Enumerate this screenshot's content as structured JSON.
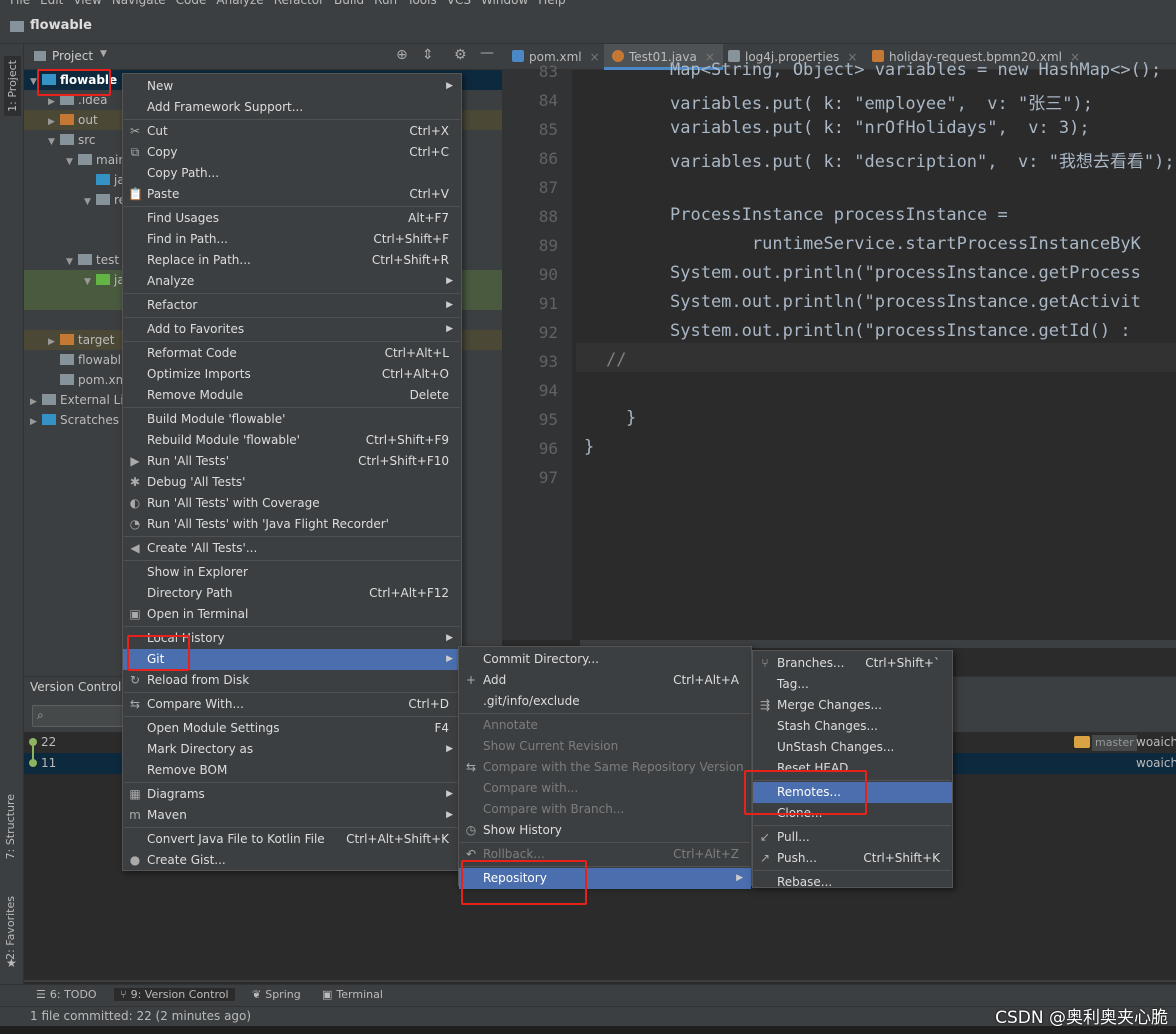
{
  "menubar": {
    "items": [
      "File",
      "Edit",
      "View",
      "Navigate",
      "Code",
      "Analyze",
      "Refactor",
      "Build",
      "Run",
      "Tools",
      "VCS",
      "Window",
      "Help"
    ]
  },
  "title": "flowable",
  "left_tabs": [
    "1: Project",
    "7: Structure",
    "2: Favorites"
  ],
  "project_panel": {
    "title": "Project",
    "tree": [
      {
        "label": "flowable",
        "indent": 0,
        "type": "root"
      },
      {
        "label": ".idea",
        "indent": 1
      },
      {
        "label": "out",
        "indent": 1
      },
      {
        "label": "src",
        "indent": 1
      },
      {
        "label": "main",
        "indent": 2
      },
      {
        "label": "ja",
        "indent": 3
      },
      {
        "label": "re",
        "indent": 3
      },
      {
        "label": "test",
        "indent": 2
      },
      {
        "label": "ja",
        "indent": 3
      },
      {
        "label": "target",
        "indent": 1
      },
      {
        "label": "flowabl",
        "indent": 1
      },
      {
        "label": "pom.xml",
        "indent": 1
      },
      {
        "label": "External Li",
        "indent": 0
      },
      {
        "label": "Scratches",
        "indent": 0
      }
    ]
  },
  "editor_tabs": [
    {
      "label": "pom.xml",
      "icon": "maven-icon"
    },
    {
      "label": "Test01.java",
      "icon": "java-class-icon",
      "active": true
    },
    {
      "label": "log4j.properties",
      "icon": "properties-icon"
    },
    {
      "label": "holiday-request.bpmn20.xml",
      "icon": "xml-icon"
    }
  ],
  "code_lines": [
    {
      "n": "83",
      "text": "Map<String, Object> variables = new HashMap<>();"
    },
    {
      "n": "84",
      "text": "variables.put( k: \"employee\",  v: \"张三\");"
    },
    {
      "n": "85",
      "text": "variables.put( k: \"nrOfHolidays\",  v: 3);"
    },
    {
      "n": "86",
      "text": "variables.put( k: \"description\",  v: \"我想去看看\");"
    },
    {
      "n": "87",
      "text": ""
    },
    {
      "n": "88",
      "text": "ProcessInstance processInstance ="
    },
    {
      "n": "89",
      "text": "        runtimeService.startProcessInstanceByK"
    },
    {
      "n": "90",
      "text": "System.out.println(\"processInstance.getProcess"
    },
    {
      "n": "91",
      "text": "System.out.println(\"processInstance.getActivit"
    },
    {
      "n": "92",
      "text": "System.out.println(\"processInstance.getId() :"
    },
    {
      "n": "93",
      "text": "//"
    },
    {
      "n": "94",
      "text": ""
    },
    {
      "n": "95",
      "text": "}"
    },
    {
      "n": "96",
      "text": "}"
    },
    {
      "n": "97",
      "text": ""
    }
  ],
  "version_control": {
    "title": "Version Control",
    "commits": [
      {
        "msg": "22",
        "branch": "master",
        "author": "woaich"
      },
      {
        "msg": "11",
        "author": "woaich"
      }
    ]
  },
  "context_menu": [
    {
      "label": "New",
      "sub": true
    },
    {
      "label": "Add Framework Support..."
    },
    {
      "sep": true
    },
    {
      "label": "Cut",
      "sc": "Ctrl+X",
      "icon": "✂"
    },
    {
      "label": "Copy",
      "sc": "Ctrl+C",
      "icon": "⧉"
    },
    {
      "label": "Copy Path..."
    },
    {
      "label": "Paste",
      "sc": "Ctrl+V",
      "icon": "📋"
    },
    {
      "sep": true
    },
    {
      "label": "Find Usages",
      "sc": "Alt+F7"
    },
    {
      "label": "Find in Path...",
      "sc": "Ctrl+Shift+F"
    },
    {
      "label": "Replace in Path...",
      "sc": "Ctrl+Shift+R"
    },
    {
      "label": "Analyze",
      "sub": true
    },
    {
      "sep": true
    },
    {
      "label": "Refactor",
      "sub": true
    },
    {
      "sep": true
    },
    {
      "label": "Add to Favorites",
      "sub": true
    },
    {
      "sep": true
    },
    {
      "label": "Reformat Code",
      "sc": "Ctrl+Alt+L"
    },
    {
      "label": "Optimize Imports",
      "sc": "Ctrl+Alt+O"
    },
    {
      "label": "Remove Module",
      "sc": "Delete"
    },
    {
      "sep": true
    },
    {
      "label": "Build Module 'flowable'"
    },
    {
      "label": "Rebuild Module 'flowable'",
      "sc": "Ctrl+Shift+F9"
    },
    {
      "label": "Run 'All Tests'",
      "sc": "Ctrl+Shift+F10",
      "icon": "▶"
    },
    {
      "label": "Debug 'All Tests'",
      "icon": "✱"
    },
    {
      "label": "Run 'All Tests' with Coverage",
      "icon": "◐"
    },
    {
      "label": "Run 'All Tests' with 'Java Flight Recorder'",
      "icon": "◔"
    },
    {
      "sep": true
    },
    {
      "label": "Create 'All Tests'...",
      "icon": "◀"
    },
    {
      "sep": true
    },
    {
      "label": "Show in Explorer"
    },
    {
      "label": "Directory Path",
      "sc": "Ctrl+Alt+F12"
    },
    {
      "label": "Open in Terminal",
      "icon": "▣"
    },
    {
      "sep": true
    },
    {
      "label": "Local History",
      "sub": true
    },
    {
      "label": "Git",
      "sub": true,
      "sel": true
    },
    {
      "label": "Reload from Disk",
      "icon": "↻"
    },
    {
      "sep": true
    },
    {
      "label": "Compare With...",
      "sc": "Ctrl+D",
      "icon": "⇆"
    },
    {
      "sep": true
    },
    {
      "label": "Open Module Settings",
      "sc": "F4"
    },
    {
      "label": "Mark Directory as",
      "sub": true
    },
    {
      "label": "Remove BOM"
    },
    {
      "sep": true
    },
    {
      "label": "Diagrams",
      "sub": true,
      "icon": "▦"
    },
    {
      "label": "Maven",
      "sub": true,
      "icon": "m"
    },
    {
      "sep": true
    },
    {
      "label": "Convert Java File to Kotlin File",
      "sc": "Ctrl+Alt+Shift+K"
    },
    {
      "label": "Create Gist...",
      "icon": "●"
    }
  ],
  "git_menu": [
    {
      "label": "Commit Directory..."
    },
    {
      "label": "Add",
      "sc": "Ctrl+Alt+A",
      "icon": "+"
    },
    {
      "label": ".git/info/exclude",
      "icon": ""
    },
    {
      "sep": true
    },
    {
      "label": "Annotate",
      "dis": true
    },
    {
      "label": "Show Current Revision",
      "dis": true
    },
    {
      "label": "Compare with the Same Repository Version",
      "dis": true,
      "icon": "⇆"
    },
    {
      "label": "Compare with...",
      "dis": true
    },
    {
      "label": "Compare with Branch...",
      "dis": true
    },
    {
      "label": "Show History",
      "icon": "◷"
    },
    {
      "sep": true
    },
    {
      "label": "Rollback...",
      "sc": "Ctrl+Alt+Z",
      "dis": true,
      "icon": "↶"
    },
    {
      "sep": true
    },
    {
      "label": "Repository",
      "sub": true,
      "sel": true
    }
  ],
  "repo_menu": [
    {
      "label": "Branches...",
      "sc": "Ctrl+Shift+`",
      "icon": "⑂"
    },
    {
      "label": "Tag..."
    },
    {
      "label": "Merge Changes...",
      "icon": "⇶"
    },
    {
      "label": "Stash Changes..."
    },
    {
      "label": "UnStash Changes..."
    },
    {
      "label": "Reset HEAD"
    },
    {
      "sep": true
    },
    {
      "label": "Remotes...",
      "sel": true
    },
    {
      "label": "Clone..."
    },
    {
      "sep": true
    },
    {
      "label": "Pull...",
      "icon": "↙"
    },
    {
      "label": "Push...",
      "sc": "Ctrl+Shift+K",
      "icon": "↗"
    },
    {
      "sep": true
    },
    {
      "label": "Rebase..."
    }
  ],
  "bottom_tabs": [
    {
      "label": "6: TODO",
      "icon": "☰"
    },
    {
      "label": "9: Version Control",
      "icon": "⑂",
      "active": true
    },
    {
      "label": "Spring",
      "icon": "❦"
    },
    {
      "label": "Terminal",
      "icon": "▣"
    }
  ],
  "status": "1 file committed: 22 (2 minutes ago)",
  "watermark": "CSDN @奥利奥夹心脆",
  "colors": {
    "selection": "#4b6eaf",
    "highlight_box": "#e8211b",
    "panel": "#3c3f41",
    "editor": "#2b2b2b"
  }
}
